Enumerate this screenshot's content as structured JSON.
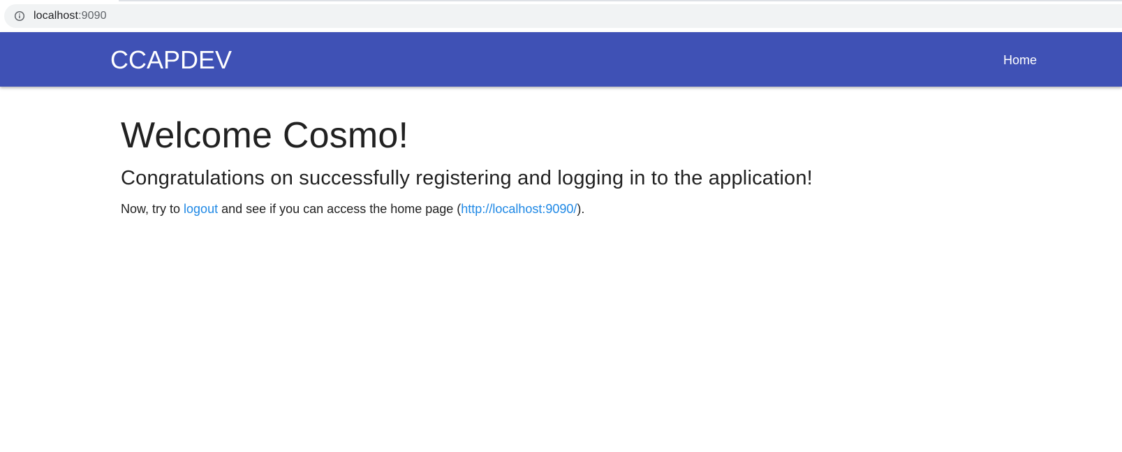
{
  "browser": {
    "url_host": "localhost",
    "url_port": ":9090",
    "info_icon": "info-circle-icon"
  },
  "navbar": {
    "brand": "CCAPDEV",
    "home_label": "Home",
    "background_color": "#3f51b5"
  },
  "main": {
    "heading": "Welcome Cosmo!",
    "subheading": "Congratulations on successfully registering and logging in to the application!",
    "paragraph": {
      "text_before": "Now, try to ",
      "logout_link": "logout",
      "text_middle": " and see if you can access the home page (",
      "home_url_link": "http://localhost:9090/",
      "text_after": ")."
    },
    "link_color": "#1e88e5"
  }
}
